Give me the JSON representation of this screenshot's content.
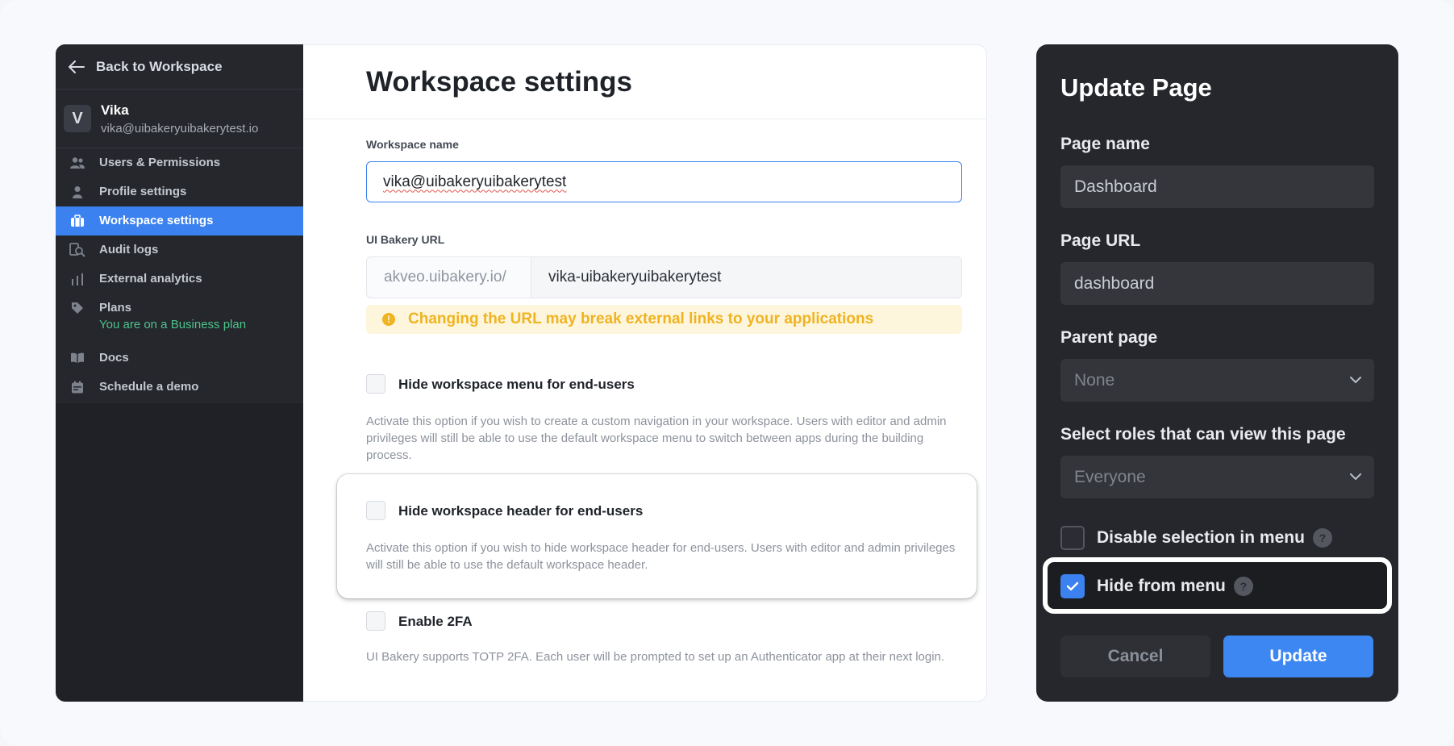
{
  "sidebar": {
    "back_label": "Back to Workspace",
    "user": {
      "initial": "V",
      "name": "Vika",
      "email": "vika@uibakeryuibakerytest.io"
    },
    "items": [
      {
        "label": "Users & Permissions",
        "icon": "users-icon"
      },
      {
        "label": "Profile settings",
        "icon": "person-icon"
      },
      {
        "label": "Workspace settings",
        "icon": "briefcase-icon",
        "active": true
      },
      {
        "label": "Audit logs",
        "icon": "audit-search-icon"
      },
      {
        "label": "External analytics",
        "icon": "bar-chart-icon"
      },
      {
        "label": "Plans",
        "icon": "tag-icon",
        "sub": "You are on a Business plan"
      },
      {
        "label": "Docs",
        "icon": "book-icon"
      },
      {
        "label": "Schedule a demo",
        "icon": "calendar-icon"
      }
    ]
  },
  "main": {
    "title": "Workspace settings",
    "workspace_name_label": "Workspace name",
    "workspace_name_value": "vika@uibakeryuibakerytest",
    "url_label": "UI Bakery URL",
    "url_prefix": "akveo.uibakery.io/",
    "url_value": "vika-uibakeryuibakerytest",
    "url_warning": "Changing the URL may break external links to your applications",
    "options": [
      {
        "title": "Hide workspace menu for end-users",
        "desc": "Activate this option if you wish to create a custom navigation in your workspace. Users with editor and admin privileges will still be able to use the default workspace menu to switch between apps during the building process."
      },
      {
        "title": "Hide workspace header for end-users",
        "desc": "Activate this option if you wish to hide workspace header for end-users. Users with editor and admin privileges will still be able to use the default workspace header."
      },
      {
        "title": "Enable 2FA",
        "desc": "UI Bakery supports TOTP 2FA. Each user will be prompted to set up an Authenticator app at their next login."
      }
    ]
  },
  "panel": {
    "title": "Update Page",
    "page_name_label": "Page name",
    "page_name_value": "Dashboard",
    "page_url_label": "Page URL",
    "page_url_value": "dashboard",
    "parent_label": "Parent page",
    "parent_value": "None",
    "roles_label": "Select roles that can view this page",
    "roles_value": "Everyone",
    "disable_selection_label": "Disable selection in menu",
    "hide_from_menu_label": "Hide from menu",
    "help_glyph": "?",
    "cancel_label": "Cancel",
    "update_label": "Update"
  },
  "colors": {
    "accent": "#3b82f0",
    "warning": "#f0b321",
    "sidebar_bg": "#25272d",
    "panel_bg": "#25272c"
  }
}
